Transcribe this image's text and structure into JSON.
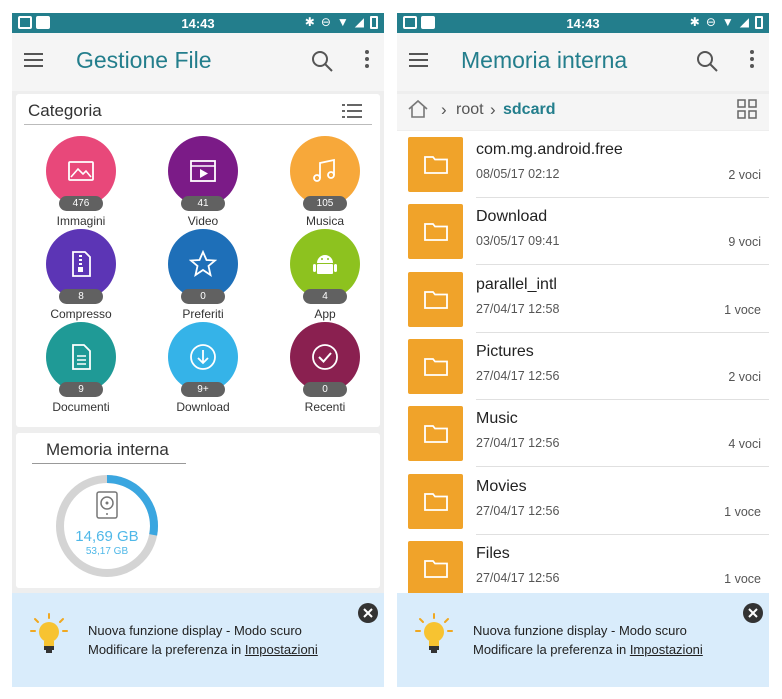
{
  "status": {
    "time": "14:43"
  },
  "left": {
    "title": "Gestione File",
    "categories_title": "Categoria",
    "categories": [
      {
        "label": "Immagini",
        "count": "476",
        "color": "#e8487a",
        "icon": "image-icon"
      },
      {
        "label": "Video",
        "count": "41",
        "color": "#7b1b87",
        "icon": "video-icon"
      },
      {
        "label": "Musica",
        "count": "105",
        "color": "#f7a83a",
        "icon": "music-icon"
      },
      {
        "label": "Compresso",
        "count": "8",
        "color": "#5c35b5",
        "icon": "zip-icon"
      },
      {
        "label": "Preferiti",
        "count": "0",
        "color": "#1e6fb8",
        "icon": "star-icon"
      },
      {
        "label": "App",
        "count": "4",
        "color": "#8dc21f",
        "icon": "android-icon"
      },
      {
        "label": "Documenti",
        "count": "9",
        "color": "#1f9a96",
        "icon": "document-icon"
      },
      {
        "label": "Download",
        "count": "9+",
        "color": "#35b3e8",
        "icon": "download-icon"
      },
      {
        "label": "Recenti",
        "count": "0",
        "color": "#8a2050",
        "icon": "recent-icon"
      }
    ],
    "storage": {
      "title": "Memoria interna",
      "used": "14,69 GB",
      "total": "53,17 GB",
      "used_fraction": 0.28,
      "used_color": "#3aa6e0"
    }
  },
  "right": {
    "title": "Memoria interna",
    "breadcrumb": {
      "root": "root",
      "current": "sdcard"
    },
    "files": [
      {
        "name": "com.mg.android.free",
        "date": "08/05/17 02:12",
        "count": "2 voci"
      },
      {
        "name": "Download",
        "date": "03/05/17 09:41",
        "count": "9 voci"
      },
      {
        "name": "parallel_intl",
        "date": "27/04/17 12:58",
        "count": "1 voce"
      },
      {
        "name": "Pictures",
        "date": "27/04/17 12:56",
        "count": "2 voci"
      },
      {
        "name": "Music",
        "date": "27/04/17 12:56",
        "count": "4 voci"
      },
      {
        "name": "Movies",
        "date": "27/04/17 12:56",
        "count": "1 voce"
      },
      {
        "name": "Files",
        "date": "27/04/17 12:56",
        "count": "1 voce"
      }
    ]
  },
  "banner": {
    "line1": "Nuova funzione display - Modo scuro",
    "line2_prefix": "Modificare la preferenza in ",
    "line2_link": "Impostazioni"
  },
  "colors": {
    "accent": "#237e8c",
    "folder": "#f0a32a",
    "banner_bg": "#d9ecfb"
  }
}
